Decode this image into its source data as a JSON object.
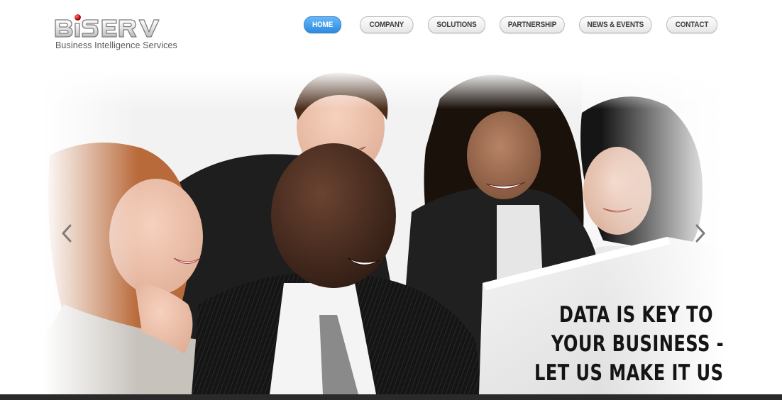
{
  "brand": {
    "logo_text": "BISERV",
    "tagline": "Business Intelligence Services",
    "accent_color": "#c8102e"
  },
  "nav": {
    "items": [
      {
        "label": "Home",
        "active": true
      },
      {
        "label": "Company",
        "active": false
      },
      {
        "label": "Solutions",
        "active": false
      },
      {
        "label": "Partnership",
        "active": false
      },
      {
        "label": "News & Events",
        "active": false
      },
      {
        "label": "Contact",
        "active": false
      }
    ],
    "active_color": "#3a97e8"
  },
  "hero": {
    "caption_lines": [
      "Data is key to",
      "your business -",
      "let us make it useful!"
    ],
    "prev_icon": "chevron-left-icon",
    "next_icon": "chevron-right-icon"
  },
  "footer": {
    "band_color": "#2a2a2a"
  }
}
